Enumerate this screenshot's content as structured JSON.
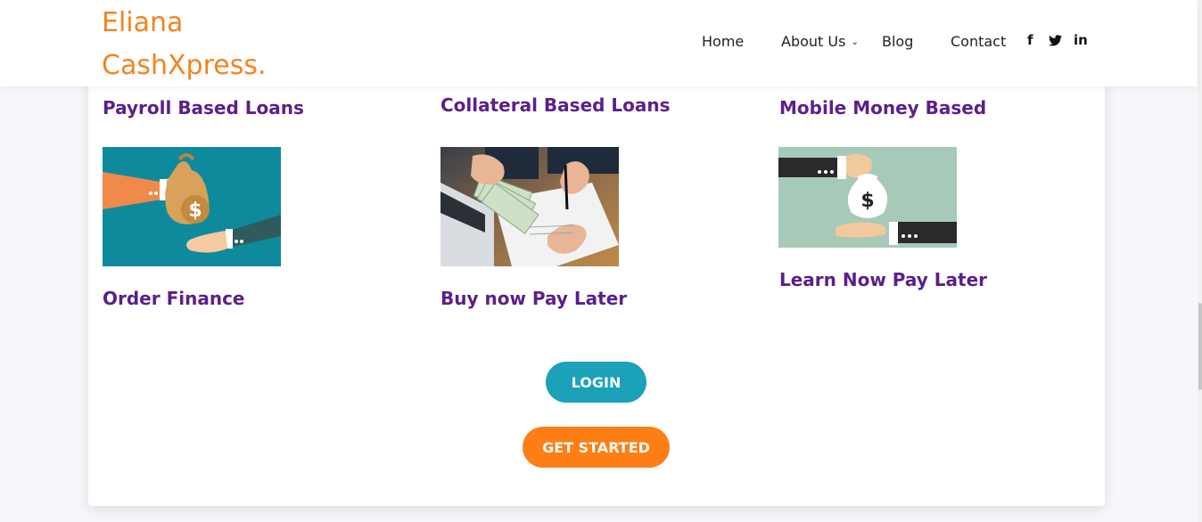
{
  "brand": {
    "line1": "Eliana",
    "line2": "CashXpress."
  },
  "nav": {
    "home": "Home",
    "about": "About Us",
    "blog": "Blog",
    "contact": "Contact"
  },
  "social": {
    "facebook": "f",
    "twitter_icon": "twitter-icon",
    "linkedin": "in"
  },
  "products": {
    "row1": [
      "Payroll Based Loans",
      "Collateral Based Loans",
      "Mobile Money Based"
    ],
    "row2": [
      "Order Finance",
      "Buy now Pay Later",
      "Learn Now Pay Later"
    ]
  },
  "buttons": {
    "login": "LOGIN",
    "get_started": "GET STARTED"
  },
  "colors": {
    "brand_orange": "#f4831f",
    "title_purple": "#5b1f8a",
    "login_teal": "#1ba1b8",
    "cta_orange": "#fd7e14"
  }
}
